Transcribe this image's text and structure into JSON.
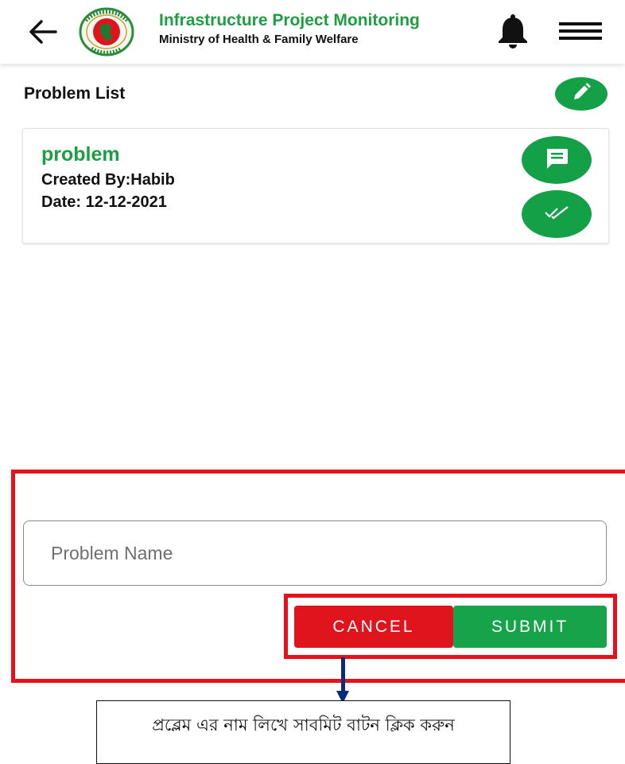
{
  "header": {
    "title": "Infrastructure Project Monitoring",
    "subtitle": "Ministry of Health & Family Welfare",
    "icons": [
      "back-arrow-icon",
      "government-seal-logo",
      "bell-icon",
      "hamburger-menu-icon"
    ]
  },
  "section": {
    "title": "Problem List",
    "action_icon": "pencil-icon"
  },
  "problem_card": {
    "title": "problem",
    "created_by": "Created By:Habib",
    "date": "Date: 12-12-2021",
    "action_icons": [
      "comment-icon",
      "double-check-icon"
    ]
  },
  "form": {
    "input_placeholder": "Problem Name",
    "input_value": "",
    "cancel_label": "CANCEL",
    "submit_label": "SUBMIT"
  },
  "annotation": {
    "text": "প্রব্লেম এর নাম লিখে সাবমিট বাটন ক্লিক করুন"
  },
  "colors": {
    "brand_green": "#1e9e43",
    "fab_green": "#14a047",
    "cancel_red": "#e0141d",
    "highlight_red": "#e8101a",
    "arrow_navy": "#0b2a78"
  }
}
